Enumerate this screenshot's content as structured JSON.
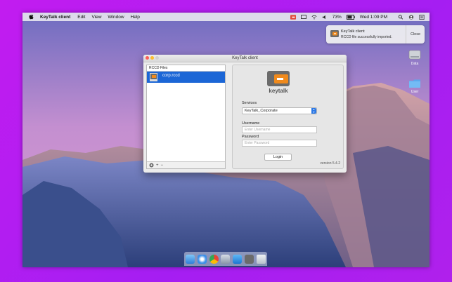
{
  "menubar": {
    "app_name": "KeyTalk client",
    "menus": [
      "Edit",
      "View",
      "Window",
      "Help"
    ],
    "battery": "73%",
    "clock": "Wed 1:09 PM"
  },
  "notification": {
    "title": "KeyTalk client",
    "message": "RCCD file successfully imported.",
    "close_label": "Close"
  },
  "desktop_icons": [
    "Data",
    "User"
  ],
  "window": {
    "title": "KeyTalk client",
    "rccd_header": "RCCD Files",
    "files": [
      {
        "name": "corp.rccd"
      }
    ],
    "logo_text": "keytalk",
    "services_label": "Services",
    "service_selected": "KeyTalk_Corporate",
    "username_label": "Username",
    "username_placeholder": "Enter Username",
    "password_label": "Password",
    "password_placeholder": "Enter Password",
    "login_label": "Login",
    "version": "version 5.4.2",
    "footer_buttons": {
      "add": "+",
      "remove": "−"
    }
  },
  "colors": {
    "accent": "#1b66d6",
    "keytalk_orange": "#f08a1c",
    "keytalk_gray": "#6b6b6b"
  }
}
